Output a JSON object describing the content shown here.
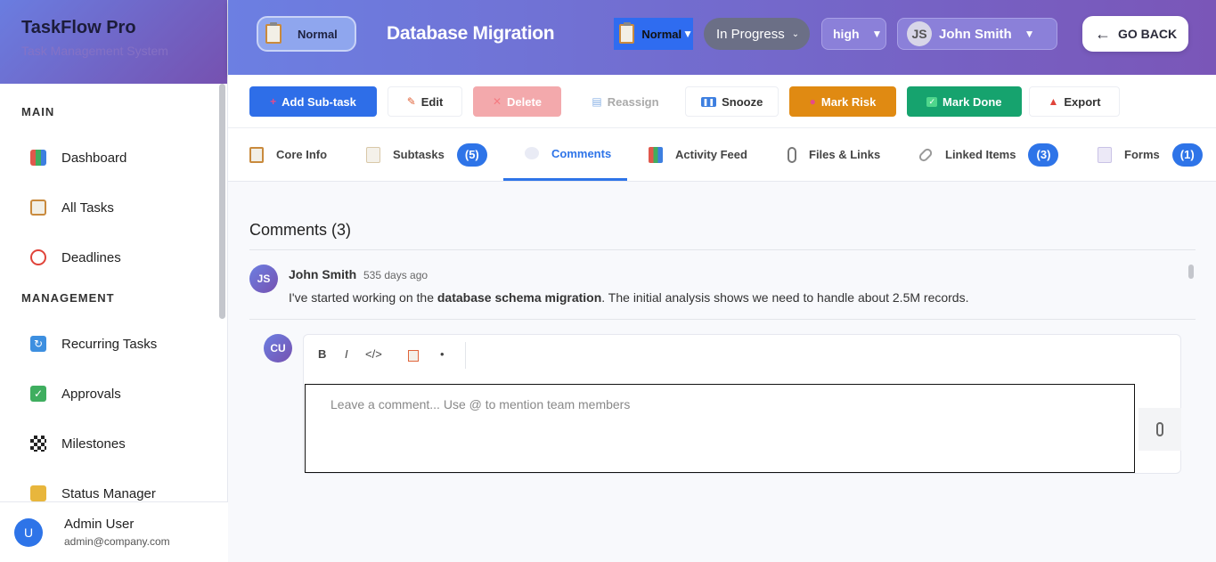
{
  "sidebar": {
    "title": "TaskFlow Pro",
    "subtitle": "Task Management System",
    "sections": [
      {
        "label": "MAIN"
      },
      {
        "label": "MANAGEMENT"
      }
    ],
    "items": [
      {
        "label": "Dashboard"
      },
      {
        "label": "All Tasks"
      },
      {
        "label": "Deadlines"
      },
      {
        "label": "Recurring Tasks"
      },
      {
        "label": "Approvals"
      },
      {
        "label": "Milestones"
      },
      {
        "label": "Status Manager"
      }
    ],
    "user": {
      "initial": "U",
      "name": "Admin User",
      "email": "admin@company.com"
    }
  },
  "header": {
    "type_pill": "Normal",
    "title": "Database Migration",
    "type_select": "Normal",
    "status_select": "In Progress",
    "priority_select": "high",
    "assignee": {
      "initials": "JS",
      "name": "John Smith"
    },
    "back_label": "GO BACK"
  },
  "toolbar": {
    "add_subtask": "Add Sub-task",
    "edit": "Edit",
    "delete": "Delete",
    "reassign": "Reassign",
    "snooze": "Snooze",
    "mark_risk": "Mark Risk",
    "mark_done": "Mark Done",
    "export": "Export"
  },
  "tabs": [
    {
      "label": "Core Info"
    },
    {
      "label": "Subtasks",
      "badge": "(5)"
    },
    {
      "label": "Comments"
    },
    {
      "label": "Activity Feed"
    },
    {
      "label": "Files & Links"
    },
    {
      "label": "Linked Items",
      "badge": "(3)"
    },
    {
      "label": "Forms",
      "badge": "(1)"
    }
  ],
  "comments": {
    "heading": "Comments (3)",
    "list": [
      {
        "initials": "JS",
        "author": "John Smith",
        "time": "535 days ago",
        "text_before": "I've started working on the ",
        "text_bold": "database schema migration",
        "text_after": ". The initial analysis shows we need to handle about 2.5M records."
      }
    ],
    "composer": {
      "initials": "CU",
      "placeholder": "Leave a comment... Use @ to mention team members",
      "format_bold": "B",
      "format_italic": "I",
      "format_code": "</>",
      "format_bullet": "•"
    }
  },
  "colors": {
    "accent": "#2e74e8",
    "header_start": "#6c7fe2",
    "header_end": "#7a56b8",
    "mark_risk": "#e08a12",
    "mark_done": "#16a36e",
    "delete": "#f3a9ac"
  }
}
